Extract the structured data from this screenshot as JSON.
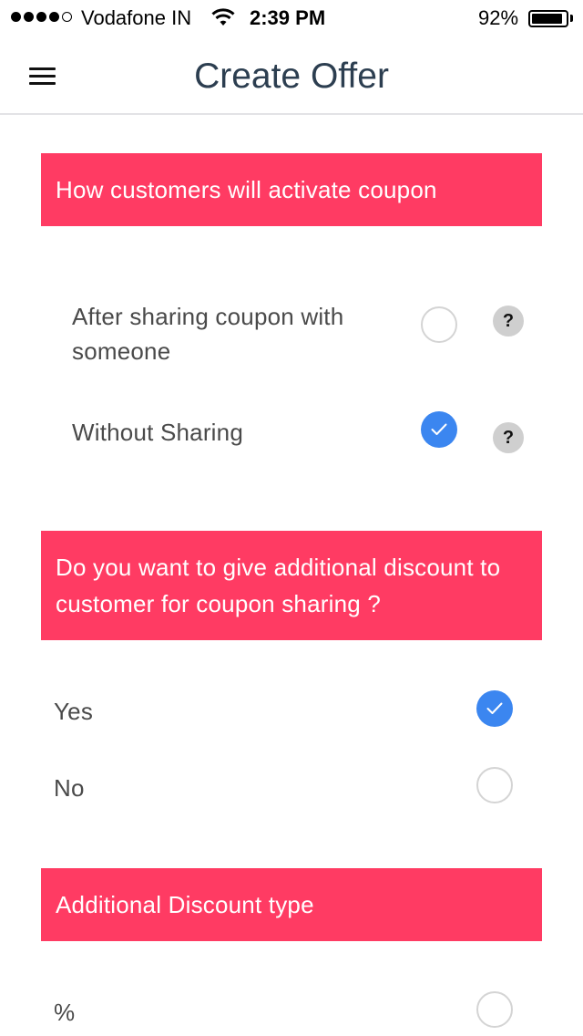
{
  "status_bar": {
    "carrier": "Vodafone IN",
    "time": "2:39 PM",
    "battery": "92%",
    "battery_level": 0.92,
    "signal_bars_filled": 4,
    "signal_bars_total": 5
  },
  "nav": {
    "title": "Create Offer",
    "menu_icon": "hamburger-icon"
  },
  "sections": {
    "activation": {
      "header": "How customers will activate coupon",
      "options": [
        {
          "label": "After sharing coupon with someone",
          "checked": false,
          "help": "?"
        },
        {
          "label": "Without Sharing",
          "checked": true,
          "help": "?"
        }
      ]
    },
    "additional_discount": {
      "header": "Do you want to give additional discount to customer for coupon sharing ?",
      "options": [
        {
          "label": "Yes",
          "checked": true
        },
        {
          "label": "No",
          "checked": false
        }
      ]
    },
    "discount_type": {
      "header": "Additional Discount type",
      "options": [
        {
          "label": "%",
          "checked": false
        }
      ]
    }
  },
  "colors": {
    "accent": "#ff3b63",
    "radio_checked": "#3b86f0",
    "title": "#2c3e50"
  }
}
